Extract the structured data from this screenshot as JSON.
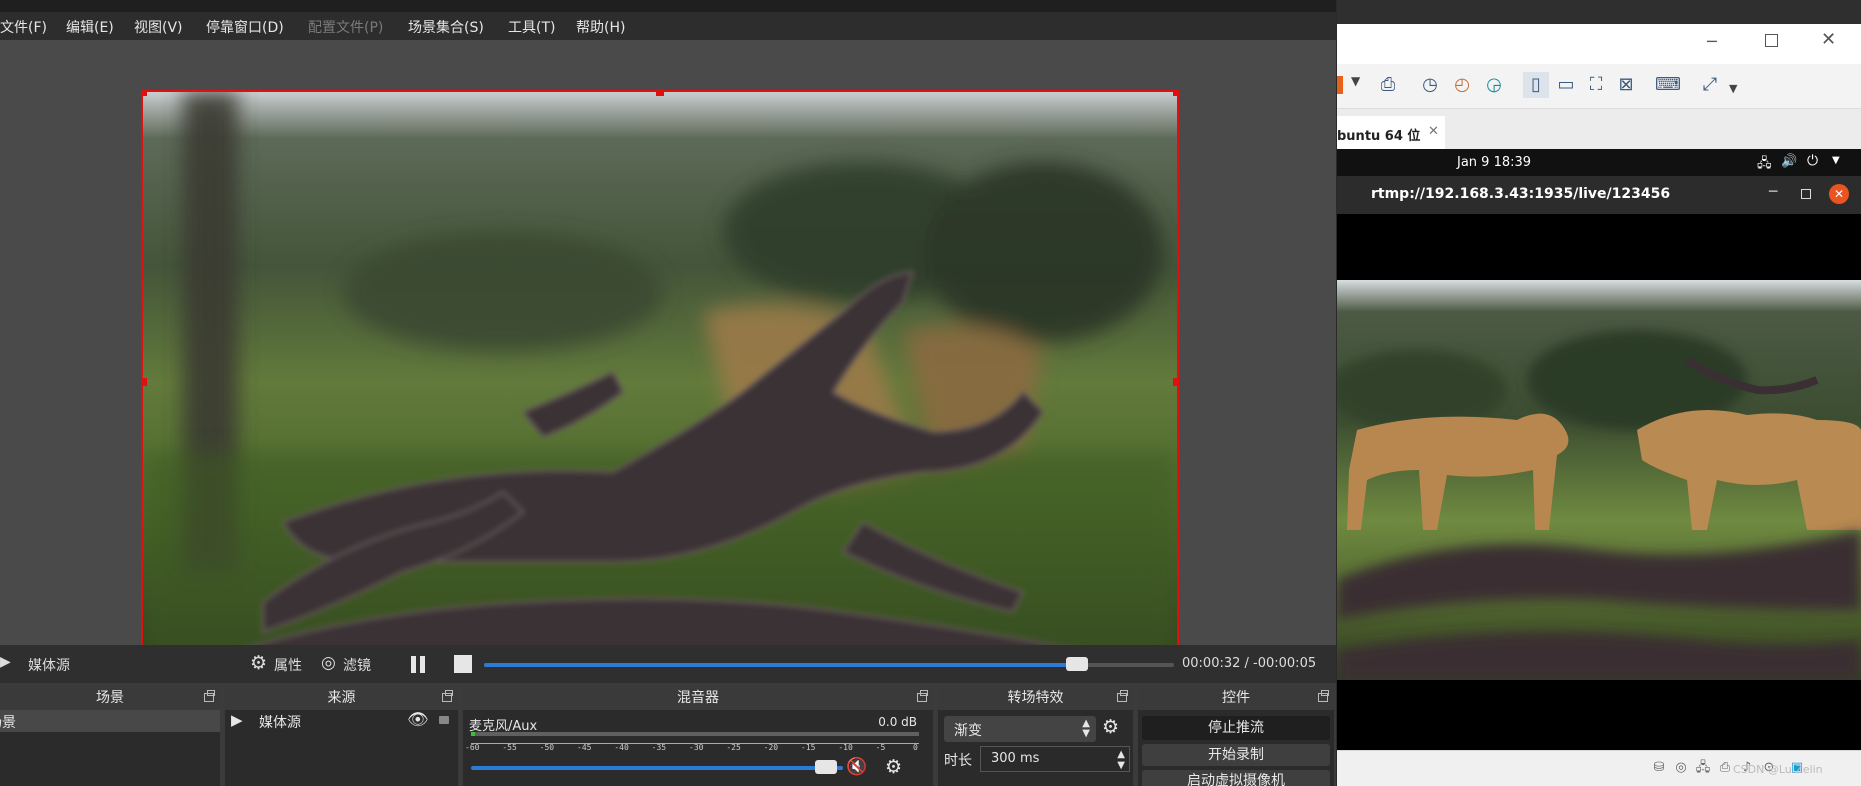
{
  "obs": {
    "menu": [
      {
        "label": "文件(F)",
        "disabled": false
      },
      {
        "label": "编辑(E)",
        "disabled": false
      },
      {
        "label": "视图(V)",
        "disabled": false
      },
      {
        "label": "停靠窗口(D)",
        "disabled": false
      },
      {
        "label": "配置文件(P)",
        "disabled": true
      },
      {
        "label": "场景集合(S)",
        "disabled": false
      },
      {
        "label": "工具(T)",
        "disabled": false
      },
      {
        "label": "帮助(H)",
        "disabled": false
      }
    ],
    "media_bar": {
      "source_name": "媒体源",
      "properties_label": "属性",
      "filters_label": "滤镜",
      "time": "00:00:32 / -00:00:05",
      "progress": 0.86
    },
    "docks": {
      "scenes": {
        "title": "场景",
        "items": [
          "场景"
        ]
      },
      "sources": {
        "title": "来源",
        "items": [
          "媒体源"
        ]
      },
      "mixer": {
        "title": "混音器",
        "channel_name": "麦克风/Aux",
        "level": "0.0 dB",
        "scale": [
          "-60",
          "-55",
          "-50",
          "-45",
          "-40",
          "-35",
          "-30",
          "-25",
          "-20",
          "-15",
          "-10",
          "-5",
          "0"
        ],
        "volume": 0.98
      },
      "transitions": {
        "title": "转场特效",
        "selected": "渐变",
        "duration_label": "时长",
        "duration_value": "300 ms"
      },
      "controls": {
        "title": "控件",
        "buttons": [
          "停止推流",
          "开始录制",
          "启动虚拟摄像机"
        ]
      }
    }
  },
  "vmware": {
    "tab_label": "buntu 64 位",
    "clock": "Jan 9  18:39",
    "player_title": "rtmp://192.168.3.43:1935/live/123456",
    "watermark": "CSDN @Lu Zelin"
  },
  "colors": {
    "selection": "#e01010",
    "accent": "#2b7bd6"
  }
}
